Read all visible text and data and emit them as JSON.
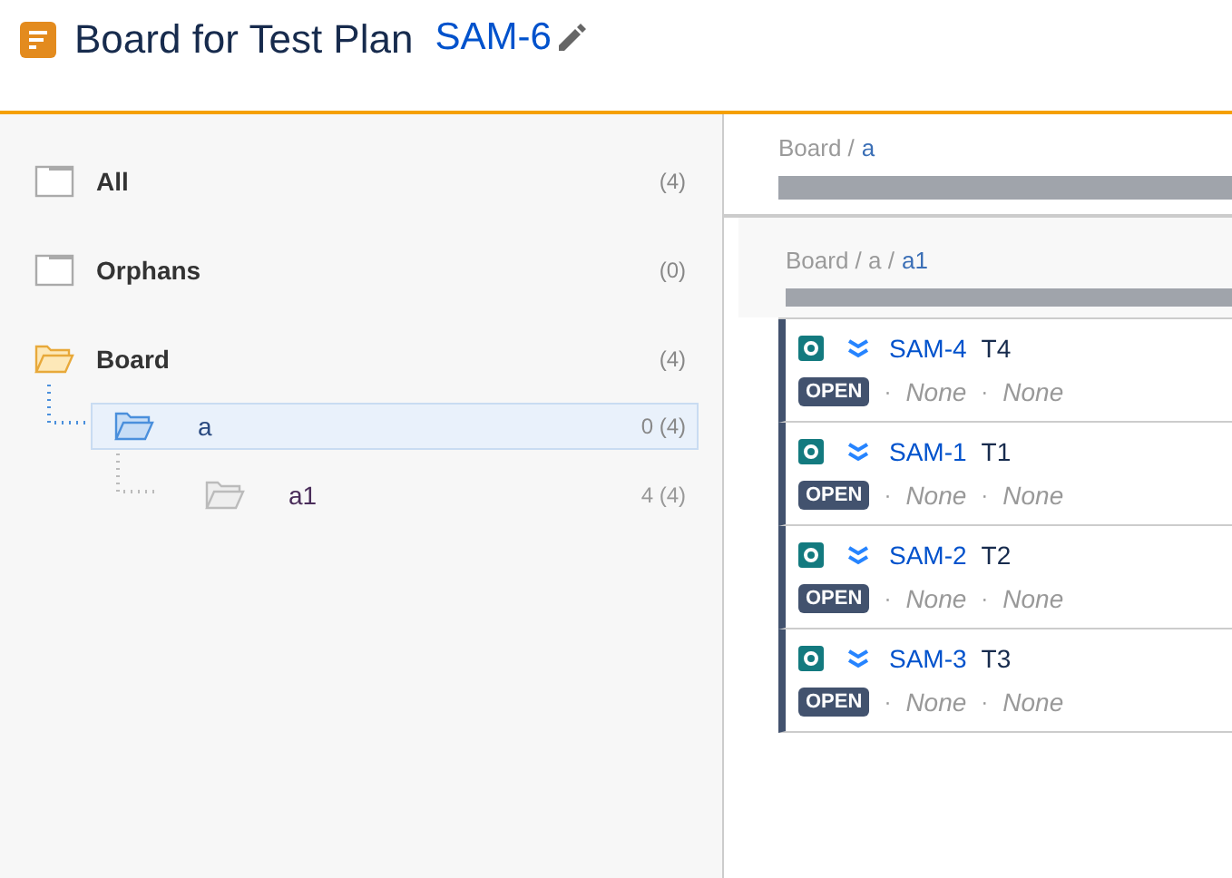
{
  "header": {
    "title": "Board for Test Plan",
    "key": "SAM-6"
  },
  "tree": [
    {
      "label": "All",
      "count": "(4)",
      "kind": "plain",
      "selected": false,
      "dimmed": false
    },
    {
      "label": "Orphans",
      "count": "(0)",
      "kind": "plain",
      "selected": false,
      "dimmed": false
    },
    {
      "label": "Board",
      "count": "(4)",
      "kind": "open",
      "selected": false,
      "dimmed": false,
      "children": [
        {
          "label": "a",
          "count": "0 (4)",
          "kind": "blue",
          "selected": true,
          "dimmed": false,
          "children": [
            {
              "label": "a1",
              "count": "4 (4)",
              "kind": "grey",
              "selected": false,
              "dimmed": true
            }
          ]
        }
      ]
    }
  ],
  "sections": [
    {
      "path": "Board /",
      "current": "a",
      "level": 1
    },
    {
      "path": "Board / a /",
      "current": "a1",
      "level": 1,
      "cards": [
        {
          "key": "SAM-4",
          "summary": "T4",
          "status": "OPEN",
          "meta": [
            {
              "kind": "dot",
              "text": "·"
            },
            {
              "kind": "value",
              "text": "None"
            },
            {
              "kind": "dot",
              "text": "·"
            },
            {
              "kind": "value",
              "text": "None"
            }
          ]
        },
        {
          "key": "SAM-1",
          "summary": "T1",
          "status": "OPEN",
          "meta": [
            {
              "kind": "dot",
              "text": "·"
            },
            {
              "kind": "value",
              "text": "None"
            },
            {
              "kind": "dot",
              "text": "·"
            },
            {
              "kind": "value",
              "text": "None"
            }
          ]
        },
        {
          "key": "SAM-2",
          "summary": "T2",
          "status": "OPEN",
          "meta": [
            {
              "kind": "dot",
              "text": "·"
            },
            {
              "kind": "value",
              "text": "None"
            },
            {
              "kind": "dot",
              "text": "·"
            },
            {
              "kind": "value",
              "text": "None"
            }
          ]
        },
        {
          "key": "SAM-3",
          "summary": "T3",
          "status": "OPEN",
          "meta": [
            {
              "kind": "dot",
              "text": "·"
            },
            {
              "kind": "value",
              "text": "None"
            },
            {
              "kind": "dot",
              "text": "·"
            },
            {
              "kind": "value",
              "text": "None"
            }
          ]
        }
      ]
    }
  ]
}
